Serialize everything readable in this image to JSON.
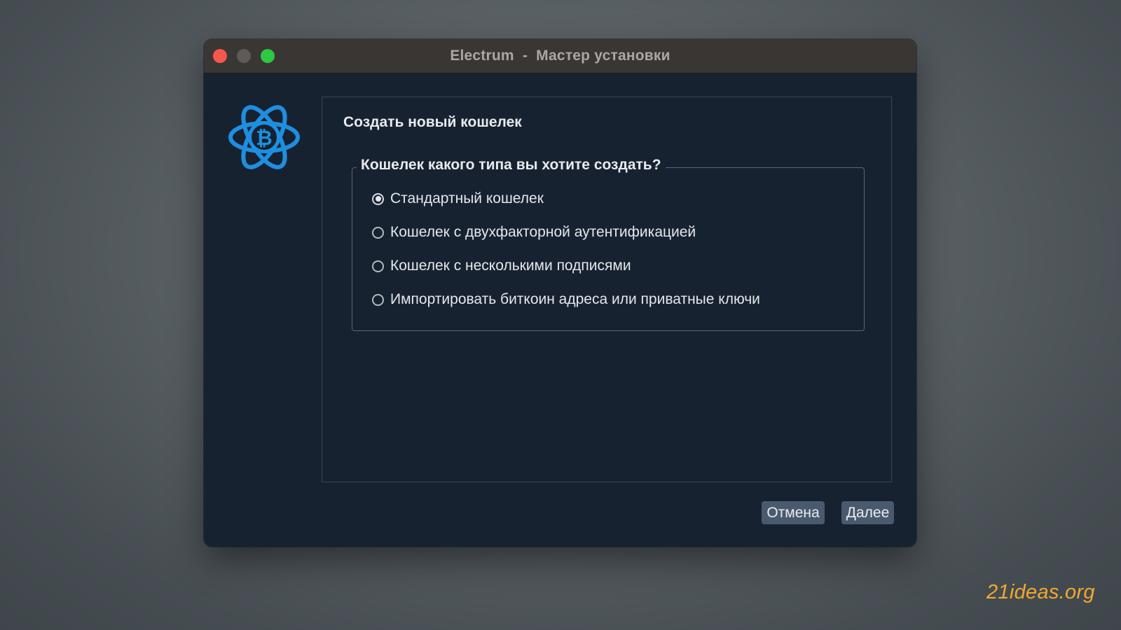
{
  "window": {
    "title": "Electrum  -  Мастер установки"
  },
  "wizard": {
    "heading": "Создать новый кошелек",
    "group_label": "Кошелек какого типа вы хотите создать?",
    "options": [
      {
        "label": "Стандартный кошелек",
        "selected": true
      },
      {
        "label": "Кошелек с двухфакторной аутентификацией",
        "selected": false
      },
      {
        "label": "Кошелек с несколькими подписями",
        "selected": false
      },
      {
        "label": "Импортировать биткоин адреса или приватные ключи",
        "selected": false
      }
    ]
  },
  "buttons": {
    "cancel_label": "Отмена",
    "next_label": "Далее"
  },
  "watermark": "21ideas.org",
  "icons": {
    "logo": "electrum-bitcoin-atom-icon"
  },
  "colors": {
    "accent_logo": "#1e8fe0",
    "window_bg": "#172231",
    "button_bg": "#4a5a6e",
    "watermark": "#f2a92d",
    "traffic_close": "#f4584d",
    "traffic_max": "#2ec843"
  }
}
